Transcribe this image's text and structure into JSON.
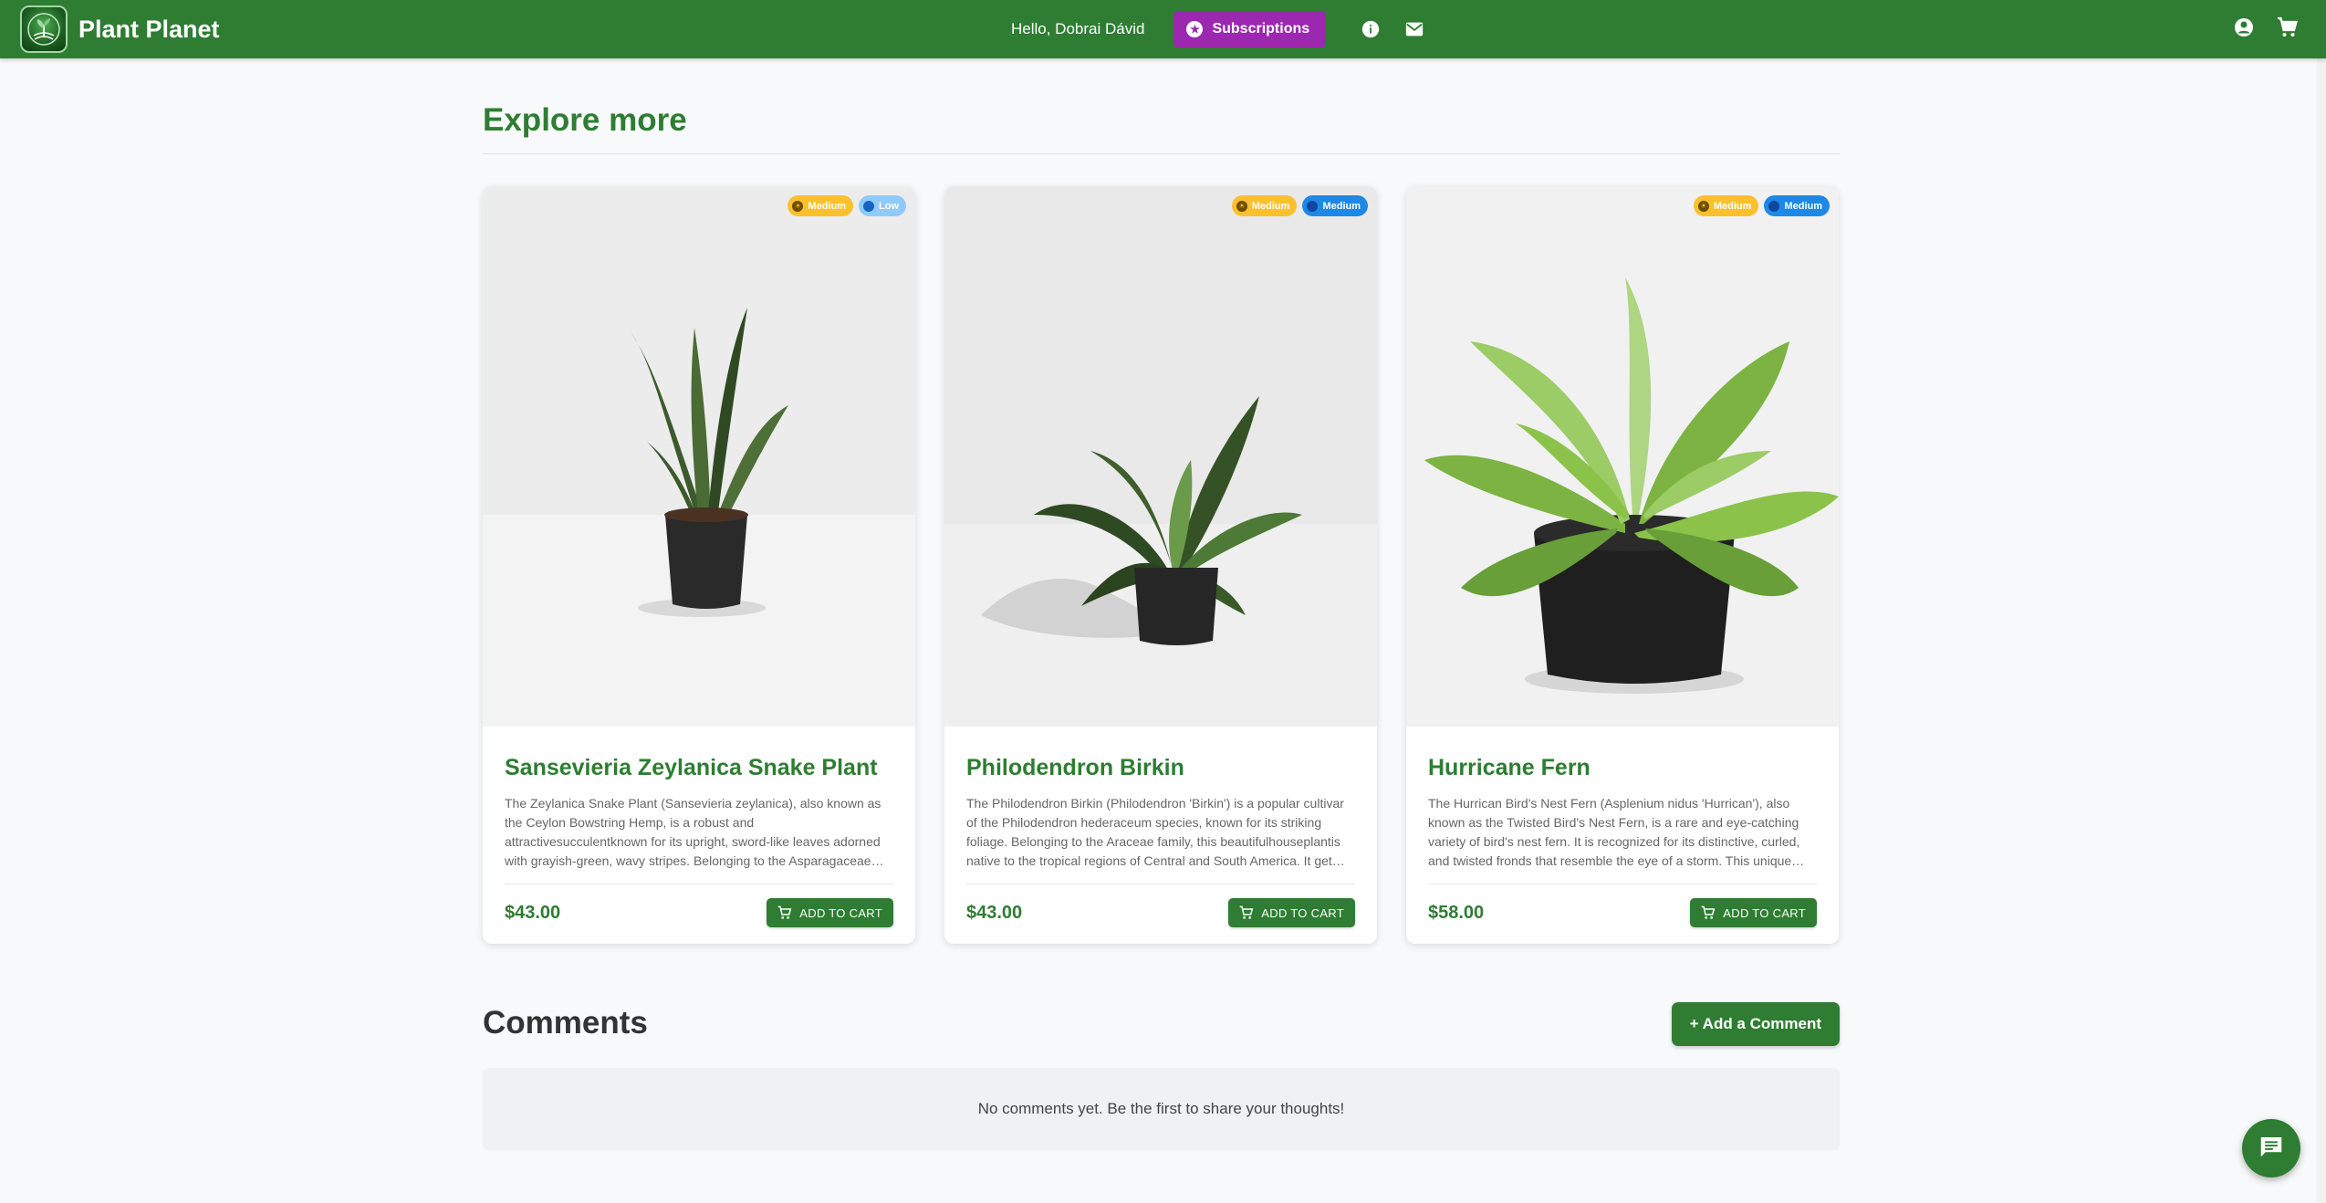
{
  "header": {
    "brand": "Plant Planet",
    "greeting": "Hello, Dobrai Dávid",
    "subscriptions_label": "Subscriptions",
    "colors": {
      "bar": "#2e7d32",
      "subscriptions": "#9c27b0"
    }
  },
  "main": {
    "section_title": "Explore more",
    "products": [
      {
        "name": "Sansevieria Zeylanica Snake Plant",
        "description": "The Zeylanica Snake Plant (Sansevieria zeylanica), also known as the Ceylon Bowstring Hemp, is a robust and attractivesucculentknown for its upright, sword-like leaves adorned with grayish-green, wavy stripes. Belonging to the Asparagaceae…",
        "price": "$43.00",
        "light": "Medium",
        "water": "Low",
        "add_label": "ADD TO CART"
      },
      {
        "name": "Philodendron Birkin",
        "description": "The Philodendron Birkin (Philodendron 'Birkin') is a popular cultivar of the Philodendron hederaceum species, known for its striking foliage. Belonging to the Araceae family, this beautifulhouseplantis native to the tropical regions of Central and South America. It get…",
        "price": "$43.00",
        "light": "Medium",
        "water": "Medium",
        "add_label": "ADD TO CART"
      },
      {
        "name": "Hurricane Fern",
        "description": "The Hurrican Bird's Nest Fern (Asplenium nidus 'Hurrican'), also known as the Twisted Bird's Nest Fern, is a rare and eye-catching variety of bird's nest fern. It is recognized for its distinctive, curled, and twisted fronds that resemble the eye of a storm. This unique…",
        "price": "$58.00",
        "light": "Medium",
        "water": "Medium",
        "add_label": "ADD TO CART"
      }
    ],
    "comments_title": "Comments",
    "add_comment_label": "+ Add a Comment",
    "empty_comments": "No comments yet. Be the first to share your thoughts!"
  },
  "icons": [
    "logo-icon",
    "star-icon",
    "info-icon",
    "mail-icon",
    "account-icon",
    "cart-icon",
    "sun-icon",
    "water-drop-icon",
    "chat-icon"
  ]
}
